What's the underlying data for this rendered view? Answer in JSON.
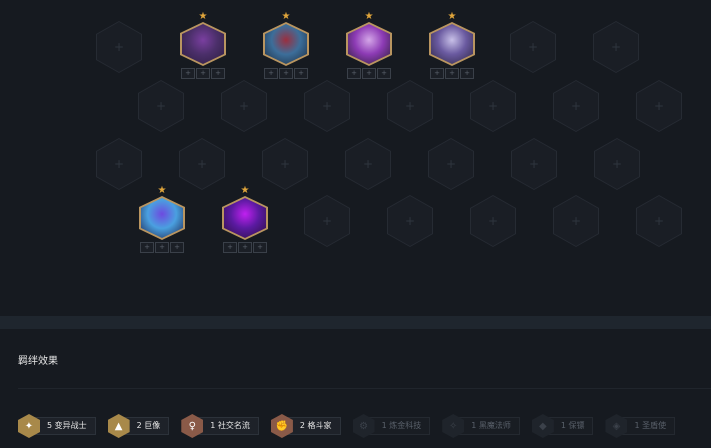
{
  "board": {
    "units": [
      {
        "id": "u1",
        "stars": "★",
        "colors": [
          "#2b1d3f",
          "#7a3fa0",
          "#4b2f6a"
        ],
        "items": [
          "+",
          "+",
          "+"
        ]
      },
      {
        "id": "u2",
        "stars": "★",
        "colors": [
          "#1c2b3f",
          "#9a2f3f",
          "#3c6e9a"
        ],
        "items": [
          "+",
          "+",
          "+"
        ]
      },
      {
        "id": "u3",
        "stars": "★",
        "colors": [
          "#2a1f36",
          "#d4a6e8",
          "#8d3bb5"
        ],
        "items": [
          "+",
          "+",
          "+"
        ]
      },
      {
        "id": "u4",
        "stars": "★",
        "colors": [
          "#2b2440",
          "#c8c0e8",
          "#6a5aa0"
        ],
        "items": [
          "+",
          "+",
          "+"
        ]
      },
      {
        "id": "u5",
        "stars": "★",
        "colors": [
          "#1b2450",
          "#6d4ae0",
          "#4aa0e0"
        ],
        "items": [
          "+",
          "+",
          "+"
        ]
      },
      {
        "id": "u6",
        "stars": "★",
        "colors": [
          "#2a0f3f",
          "#c020f0",
          "#5a1aa0"
        ],
        "items": [
          "+",
          "+",
          "+"
        ]
      }
    ],
    "empty_slot_glyph": "+"
  },
  "bonds": {
    "title": "羁绊效果",
    "traits": [
      {
        "label": "5 变异战士",
        "icon": "✦",
        "color": "#a8894a",
        "active": true
      },
      {
        "label": "2 巨像",
        "icon": "▲",
        "color": "#a8894a",
        "active": true
      },
      {
        "label": "1 社交名流",
        "icon": "♀",
        "color": "#8a5a48",
        "active": true
      },
      {
        "label": "2 格斗家",
        "icon": "✊",
        "color": "#8a5a48",
        "active": true
      },
      {
        "label": "1 炼金科技",
        "icon": "⚙",
        "color": "#1f242b",
        "active": false
      },
      {
        "label": "1 黑魔法师",
        "icon": "✧",
        "color": "#1f242b",
        "active": false
      },
      {
        "label": "1 保镖",
        "icon": "◆",
        "color": "#1f242b",
        "active": false
      },
      {
        "label": "1 圣盾使",
        "icon": "◈",
        "color": "#1f242b",
        "active": false
      }
    ]
  }
}
